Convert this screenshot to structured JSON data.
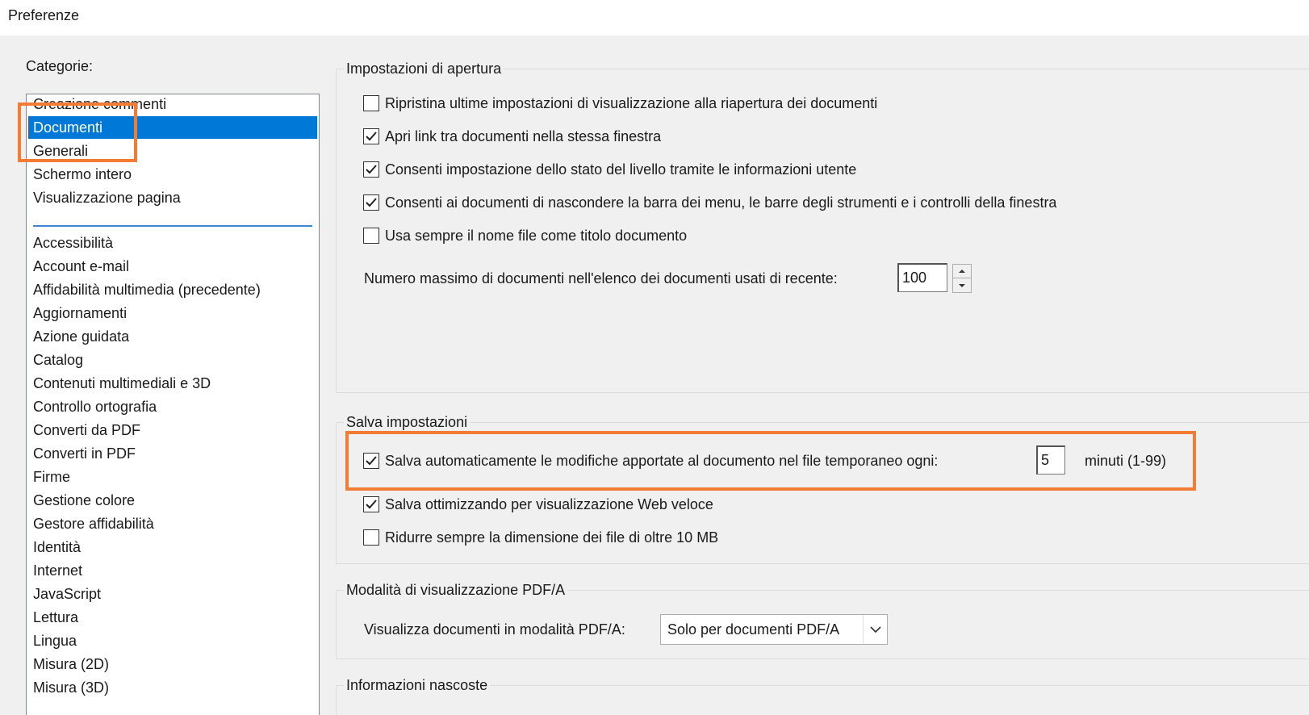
{
  "window": {
    "title": "Preferenze"
  },
  "categories": {
    "label": "Categorie:",
    "top_items": [
      "Creazione commenti",
      "Documenti",
      "Generali",
      "Schermo intero",
      "Visualizzazione pagina"
    ],
    "selected": "Documenti",
    "items": [
      "Accessibilità",
      "Account e-mail",
      "Affidabilità multimedia (precedente)",
      "Aggiornamenti",
      "Azione guidata",
      "Catalog",
      "Contenuti multimediali e 3D",
      "Controllo ortografia",
      "Converti da PDF",
      "Converti in PDF",
      "Firme",
      "Gestione colore",
      "Gestore affidabilità",
      "Identità",
      "Internet",
      "JavaScript",
      "Lettura",
      "Lingua",
      "Misura (2D)",
      "Misura (3D)"
    ]
  },
  "open_settings": {
    "title": "Impostazioni di apertura",
    "options": [
      {
        "label": "Ripristina ultime impostazioni di visualizzazione alla riapertura dei documenti",
        "checked": false
      },
      {
        "label": "Apri link tra documenti nella stessa finestra",
        "checked": true
      },
      {
        "label": "Consenti impostazione dello stato del livello tramite le informazioni utente",
        "checked": true
      },
      {
        "label": "Consenti ai documenti di nascondere la barra dei menu, le barre degli strumenti e i controlli della finestra",
        "checked": true
      },
      {
        "label": "Usa sempre il nome file come titolo documento",
        "checked": false
      }
    ],
    "max_recent_label": "Numero massimo di documenti nell'elenco dei documenti usati di recente:",
    "max_recent_value": "100"
  },
  "save_settings": {
    "title": "Salva impostazioni",
    "autosave": {
      "label": "Salva automaticamente le modifiche apportate al documento nel file temporaneo ogni:",
      "checked": true,
      "value": "5",
      "unit": "minuti (1-99)"
    },
    "options": [
      {
        "label": "Salva ottimizzando per visualizzazione Web veloce",
        "checked": true
      },
      {
        "label": "Ridurre sempre la dimensione dei file di oltre 10 MB",
        "checked": false
      }
    ]
  },
  "pdfa": {
    "title": "Modalità di visualizzazione PDF/A",
    "label": "Visualizza documenti in modalità PDF/A:",
    "selected": "Solo per documenti PDF/A"
  },
  "hidden_info": {
    "title": "Informazioni nascoste"
  },
  "colors": {
    "selection": "#0078d7",
    "highlight": "#f27b35"
  }
}
